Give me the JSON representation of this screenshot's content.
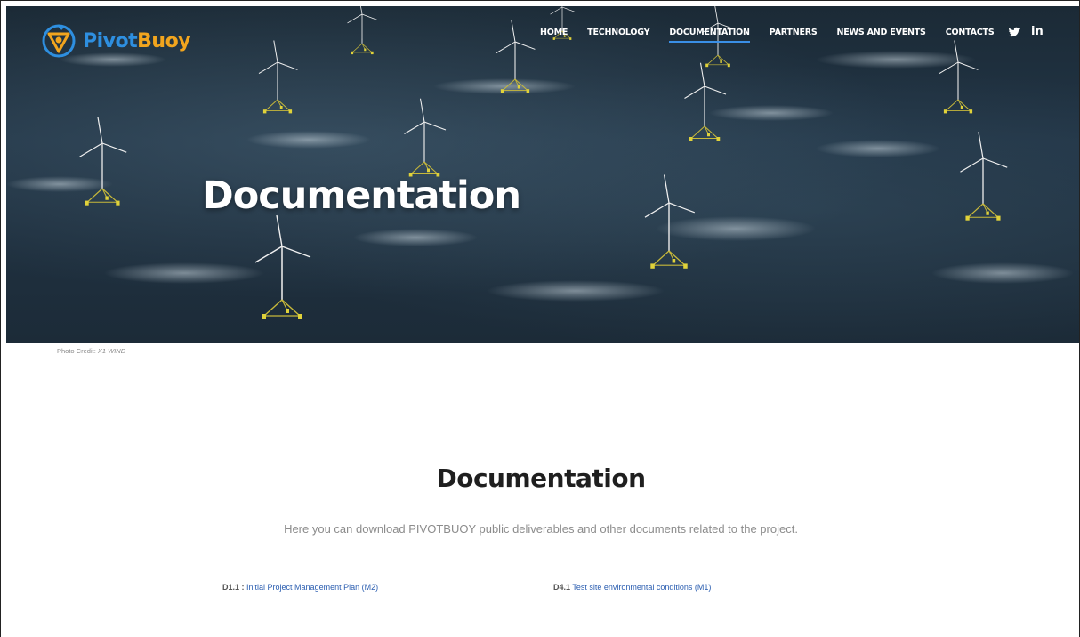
{
  "brand": {
    "name_part1": "Pivot",
    "name_part2": "Buoy",
    "primary_color": "#2e8fe0",
    "accent_color": "#f2a51e"
  },
  "nav": {
    "items": [
      {
        "label": "HOME",
        "active": false
      },
      {
        "label": "TECHNOLOGY",
        "active": false
      },
      {
        "label": "DOCUMENTATION",
        "active": true
      },
      {
        "label": "PARTNERS",
        "active": false
      },
      {
        "label": "NEWS AND EVENTS",
        "active": false
      },
      {
        "label": "CONTACTS",
        "active": false
      }
    ],
    "active_color": "#3a8fe6"
  },
  "social": {
    "twitter_icon": "twitter-icon",
    "linkedin_label": "in"
  },
  "hero": {
    "title": "Documentation",
    "photo_credit_label": "Photo Credit:",
    "photo_credit_value": "X1 WIND"
  },
  "main": {
    "title": "Documentation",
    "intro": "Here you can download PIVOTBUOY public deliverables and other documents related to the project.",
    "documents": [
      {
        "code": "D1.1 :",
        "title": "Initial Project Management Plan (M2)"
      },
      {
        "code": "D4.1",
        "title": "Test site environmental conditions (M1)"
      }
    ]
  }
}
